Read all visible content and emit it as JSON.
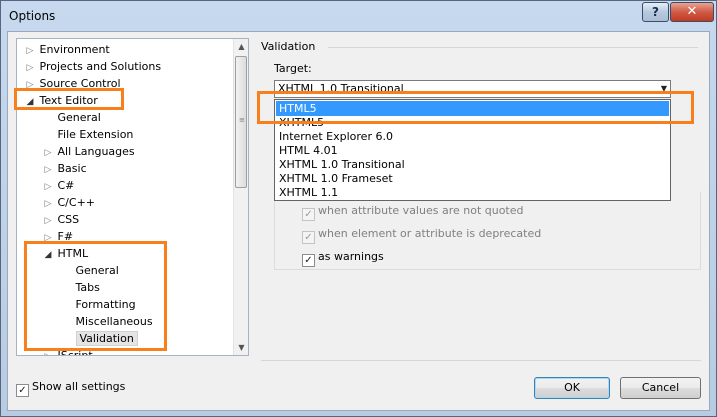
{
  "window": {
    "title": "Options",
    "help_label": "?",
    "close_label": "✕"
  },
  "tree": {
    "items": [
      {
        "label": "Environment",
        "expander": "▷"
      },
      {
        "label": "Projects and Solutions",
        "expander": "▷"
      },
      {
        "label": "Source Control",
        "expander": "▷"
      },
      {
        "label": "Text Editor",
        "expander": "◢"
      },
      {
        "label": "General",
        "expander": ""
      },
      {
        "label": "File Extension",
        "expander": ""
      },
      {
        "label": "All Languages",
        "expander": "▷"
      },
      {
        "label": "Basic",
        "expander": "▷"
      },
      {
        "label": "C#",
        "expander": "▷"
      },
      {
        "label": "C/C++",
        "expander": "▷"
      },
      {
        "label": "CSS",
        "expander": "▷"
      },
      {
        "label": "F#",
        "expander": "▷"
      },
      {
        "label": "HTML",
        "expander": "◢"
      },
      {
        "label": "General",
        "expander": ""
      },
      {
        "label": "Tabs",
        "expander": ""
      },
      {
        "label": "Formatting",
        "expander": ""
      },
      {
        "label": "Miscellaneous",
        "expander": ""
      },
      {
        "label": "Validation",
        "expander": ""
      },
      {
        "label": "JScript",
        "expander": "▷"
      }
    ],
    "selected_index": 17,
    "scroll_up": "▲",
    "scroll_down": "▼"
  },
  "validation": {
    "heading": "Validation",
    "target_label": "Target:",
    "target_value": "XHTML 1.0 Transitional",
    "dropdown_arrow": "▼",
    "options": [
      "HTML5",
      "XHTML5",
      "Internet Explorer 6.0",
      "HTML 4.01",
      "XHTML 1.0 Transitional",
      "XHTML 1.0 Frameset",
      "XHTML 1.1"
    ],
    "highlighted_index": 0,
    "checkboxes": [
      {
        "label": "when attribute values are not quoted",
        "checked": true,
        "enabled": false
      },
      {
        "label": "when element or attribute is deprecated",
        "checked": true,
        "enabled": false
      },
      {
        "label": "as warnings",
        "checked": true,
        "enabled": true
      }
    ]
  },
  "footer": {
    "show_all_label": "Show all settings",
    "show_all_checked": true,
    "ok_label": "OK",
    "cancel_label": "Cancel"
  },
  "colors": {
    "annotation": "#f7801c",
    "highlight": "#3399ff"
  }
}
